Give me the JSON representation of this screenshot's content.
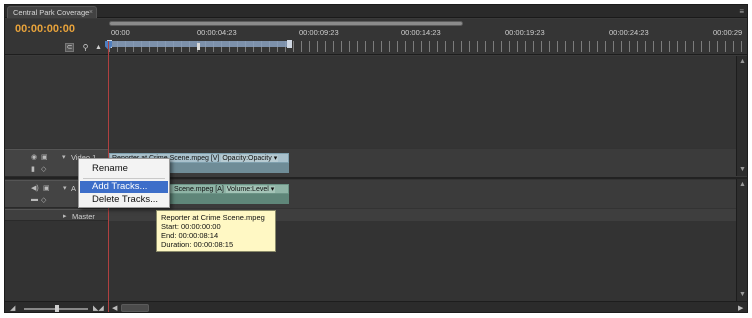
{
  "tab": {
    "title": "Central Park Coverage",
    "close": "×"
  },
  "panel_menu_icon": "≡",
  "header": {
    "timecode": "00:00:00:00",
    "ruler_labels": [
      "00:00",
      "00:00:04:23",
      "00:00:09:23",
      "00:00:14:23",
      "00:00:19:23",
      "00:00:24:23",
      "00:00:29"
    ]
  },
  "tracks": {
    "video1": {
      "label": "Video 1",
      "clip_label": "Reporter at Crime Scene.mpeg [V]",
      "clip_effect": "Opacity:Opacity ▾"
    },
    "audio1": {
      "label": "A",
      "clip_label": "Scene.mpeg [A]",
      "clip_effect": "Volume:Level ▾"
    },
    "master": {
      "label": "Master"
    }
  },
  "context_menu": {
    "items": [
      "Rename",
      "Add Tracks...",
      "Delete Tracks..."
    ],
    "highlighted": "Add Tracks..."
  },
  "tooltip": {
    "name": "Reporter at Crime Scene.mpeg",
    "start": "Start: 00:00:00:00",
    "end": "End: 00:00:08:14",
    "duration": "Duration: 00:00:08:15"
  },
  "colors": {
    "timecode": "#e8a33b",
    "playhead": "#b04040",
    "menu_highlight": "#3d6ec9",
    "tooltip_bg": "#fff8c4"
  }
}
